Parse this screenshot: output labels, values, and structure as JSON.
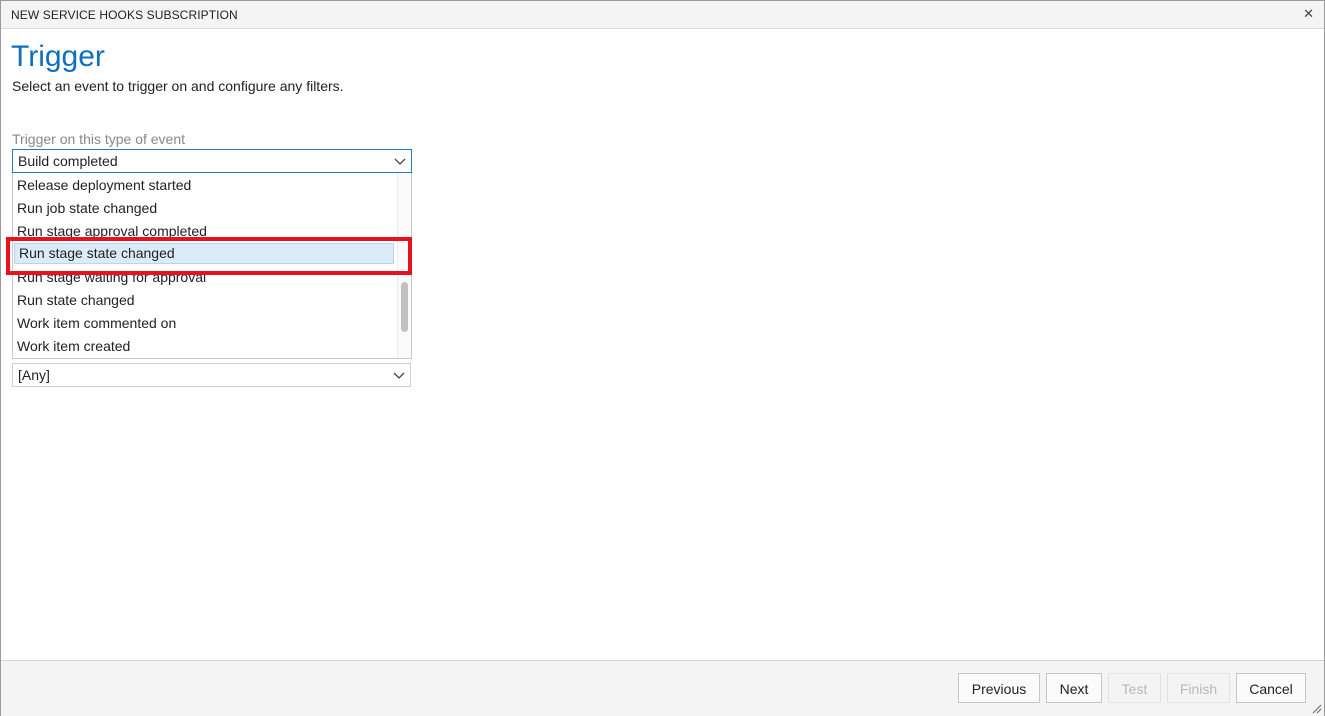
{
  "dialog": {
    "title": "NEW SERVICE HOOKS SUBSCRIPTION",
    "close_icon": "close-icon"
  },
  "page": {
    "heading": "Trigger",
    "description": "Select an event to trigger on and configure any filters."
  },
  "event_field": {
    "label": "Trigger on this type of event",
    "selected_value": "Build completed",
    "dropdown_items": [
      "Release deployment started",
      "Run job state changed",
      "Run stage approval completed",
      "Run stage state changed",
      "Run stage waiting for approval",
      "Run state changed",
      "Work item commented on",
      "Work item created"
    ],
    "highlighted_item": "Run stage state changed"
  },
  "filter_field": {
    "selected_value": "[Any]"
  },
  "footer": {
    "previous_label": "Previous",
    "next_label": "Next",
    "test_label": "Test",
    "finish_label": "Finish",
    "cancel_label": "Cancel"
  },
  "colors": {
    "heading": "#106ebe",
    "annotation_box": "#e8121e",
    "selected_item_bg": "#dcebf8"
  }
}
